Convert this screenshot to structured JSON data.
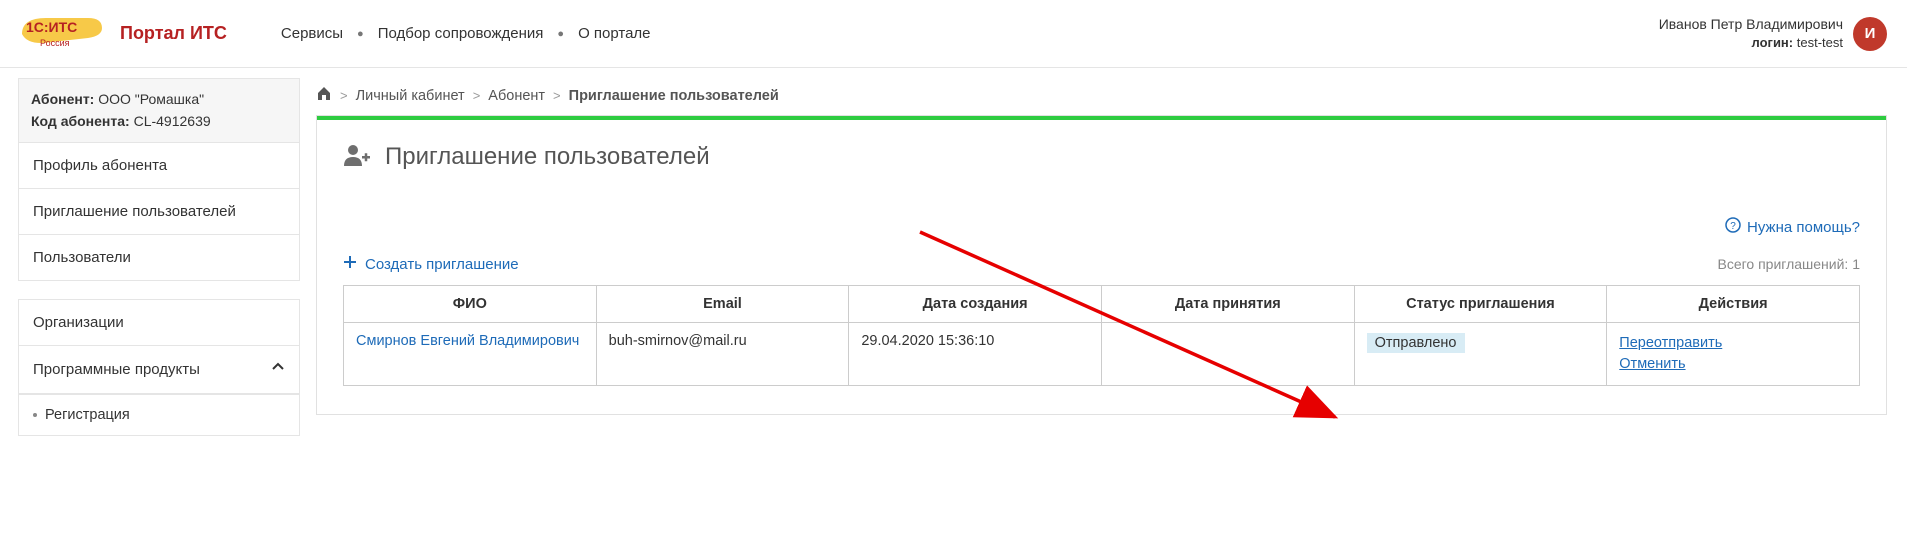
{
  "logo": {
    "title": "Портал ИТС"
  },
  "top_menu": [
    "Сервисы",
    "Подбор сопровождения",
    "О портале"
  ],
  "user": {
    "name": "Иванов Петр Владимирович",
    "login_label": "логин:",
    "login": "test-test",
    "avatar_letter": "И"
  },
  "sidebar": {
    "abonent_label": "Абонент:",
    "abonent_name": "ООО \"Ромашка\"",
    "code_label": "Код абонента:",
    "code_value": "CL-4912639",
    "items": [
      {
        "label": "Профиль абонента"
      },
      {
        "label": "Приглашение пользователей"
      },
      {
        "label": "Пользователи"
      }
    ],
    "items2": [
      {
        "label": "Организации",
        "expanded": false
      },
      {
        "label": "Программные продукты",
        "expanded": true,
        "children": [
          {
            "label": "Регистрация"
          }
        ]
      }
    ]
  },
  "breadcrumb": {
    "items": [
      {
        "label": "Личный кабинет"
      },
      {
        "label": "Абонент"
      }
    ],
    "current": "Приглашение пользователей"
  },
  "page": {
    "title": "Приглашение пользователей",
    "help_label": "Нужна помощь?",
    "create_label": "Создать приглашение",
    "total_label": "Всего приглашений:",
    "total_value": "1"
  },
  "table": {
    "headers": [
      "ФИО",
      "Email",
      "Дата создания",
      "Дата принятия",
      "Статус приглашения",
      "Действия"
    ],
    "rows": [
      {
        "fio": "Смирнов Евгений Владимирович",
        "email": "buh-smirnov@mail.ru",
        "created": "29.04.2020 15:36:10",
        "accepted": "",
        "status": "Отправлено",
        "actions": [
          "Переотправить",
          "Отменить"
        ]
      }
    ]
  }
}
